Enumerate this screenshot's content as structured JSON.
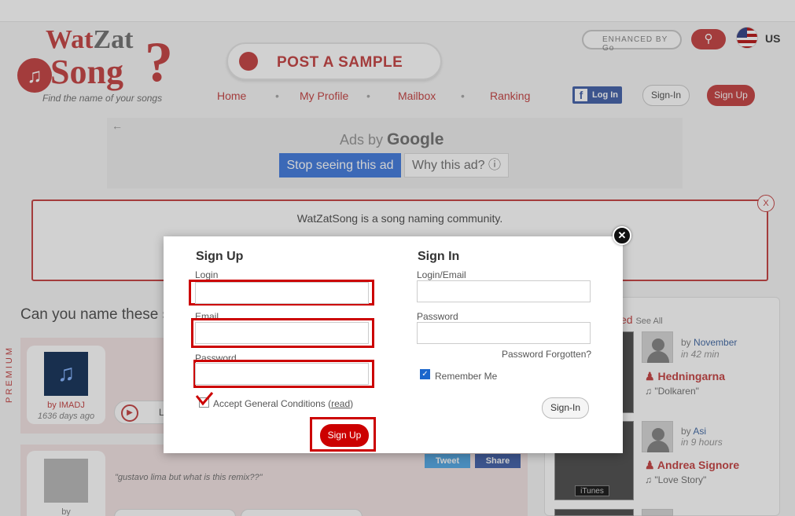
{
  "logo": {
    "wat": "Wat",
    "zat": "Zat",
    "song": "Song",
    "tagline": "Find the name of your songs"
  },
  "header": {
    "post_sample": "POST A SAMPLE",
    "search_placeholder": "ENHANCED BY Go",
    "lang": "US",
    "nav": [
      "Home",
      "My Profile",
      "Mailbox",
      "Ranking"
    ],
    "fb_login": "Log In",
    "signin": "Sign-In",
    "signup": "Sign Up"
  },
  "ad": {
    "ads_by": "Ads by",
    "google": "Google",
    "stop": "Stop seeing this ad",
    "why": "Why this ad? ⓘ"
  },
  "welcome": {
    "text": "WatZatSong is a song naming community.",
    "close": "X"
  },
  "main": {
    "heading": "Can you name these s",
    "premium": "PREMIUM",
    "card1": {
      "by": "by IMADJ",
      "days": "1636 days ago",
      "listen": "L"
    },
    "card2": {
      "comment": "\"gustavo lima but what is this remix??\"",
      "tweet": "Tweet",
      "share": "Share",
      "by": "by"
    }
  },
  "sidebar": {
    "heading": "ed",
    "see_all": "See All",
    "entries": [
      {
        "by_prefix": "by",
        "user": "November",
        "when": "in 42 min",
        "artist": "Hedningarna",
        "song": "\"Dolkaren\""
      },
      {
        "by_prefix": "by",
        "user": "Asi",
        "when": "in 9 hours",
        "artist": "Andrea Signore",
        "song": "\"Love Story\"",
        "itunes": "iTunes"
      }
    ]
  },
  "modal": {
    "close": "✕",
    "signup": {
      "title": "Sign Up",
      "login_label": "Login",
      "email_label": "Email",
      "password_label": "Password",
      "accept_text": "Accept General Conditions",
      "read_link": "read",
      "button": "Sign Up"
    },
    "signin": {
      "title": "Sign In",
      "login_label": "Login/Email",
      "password_label": "Password",
      "forgot": "Password Forgotten?",
      "remember": "Remember Me",
      "button": "Sign-In"
    }
  }
}
